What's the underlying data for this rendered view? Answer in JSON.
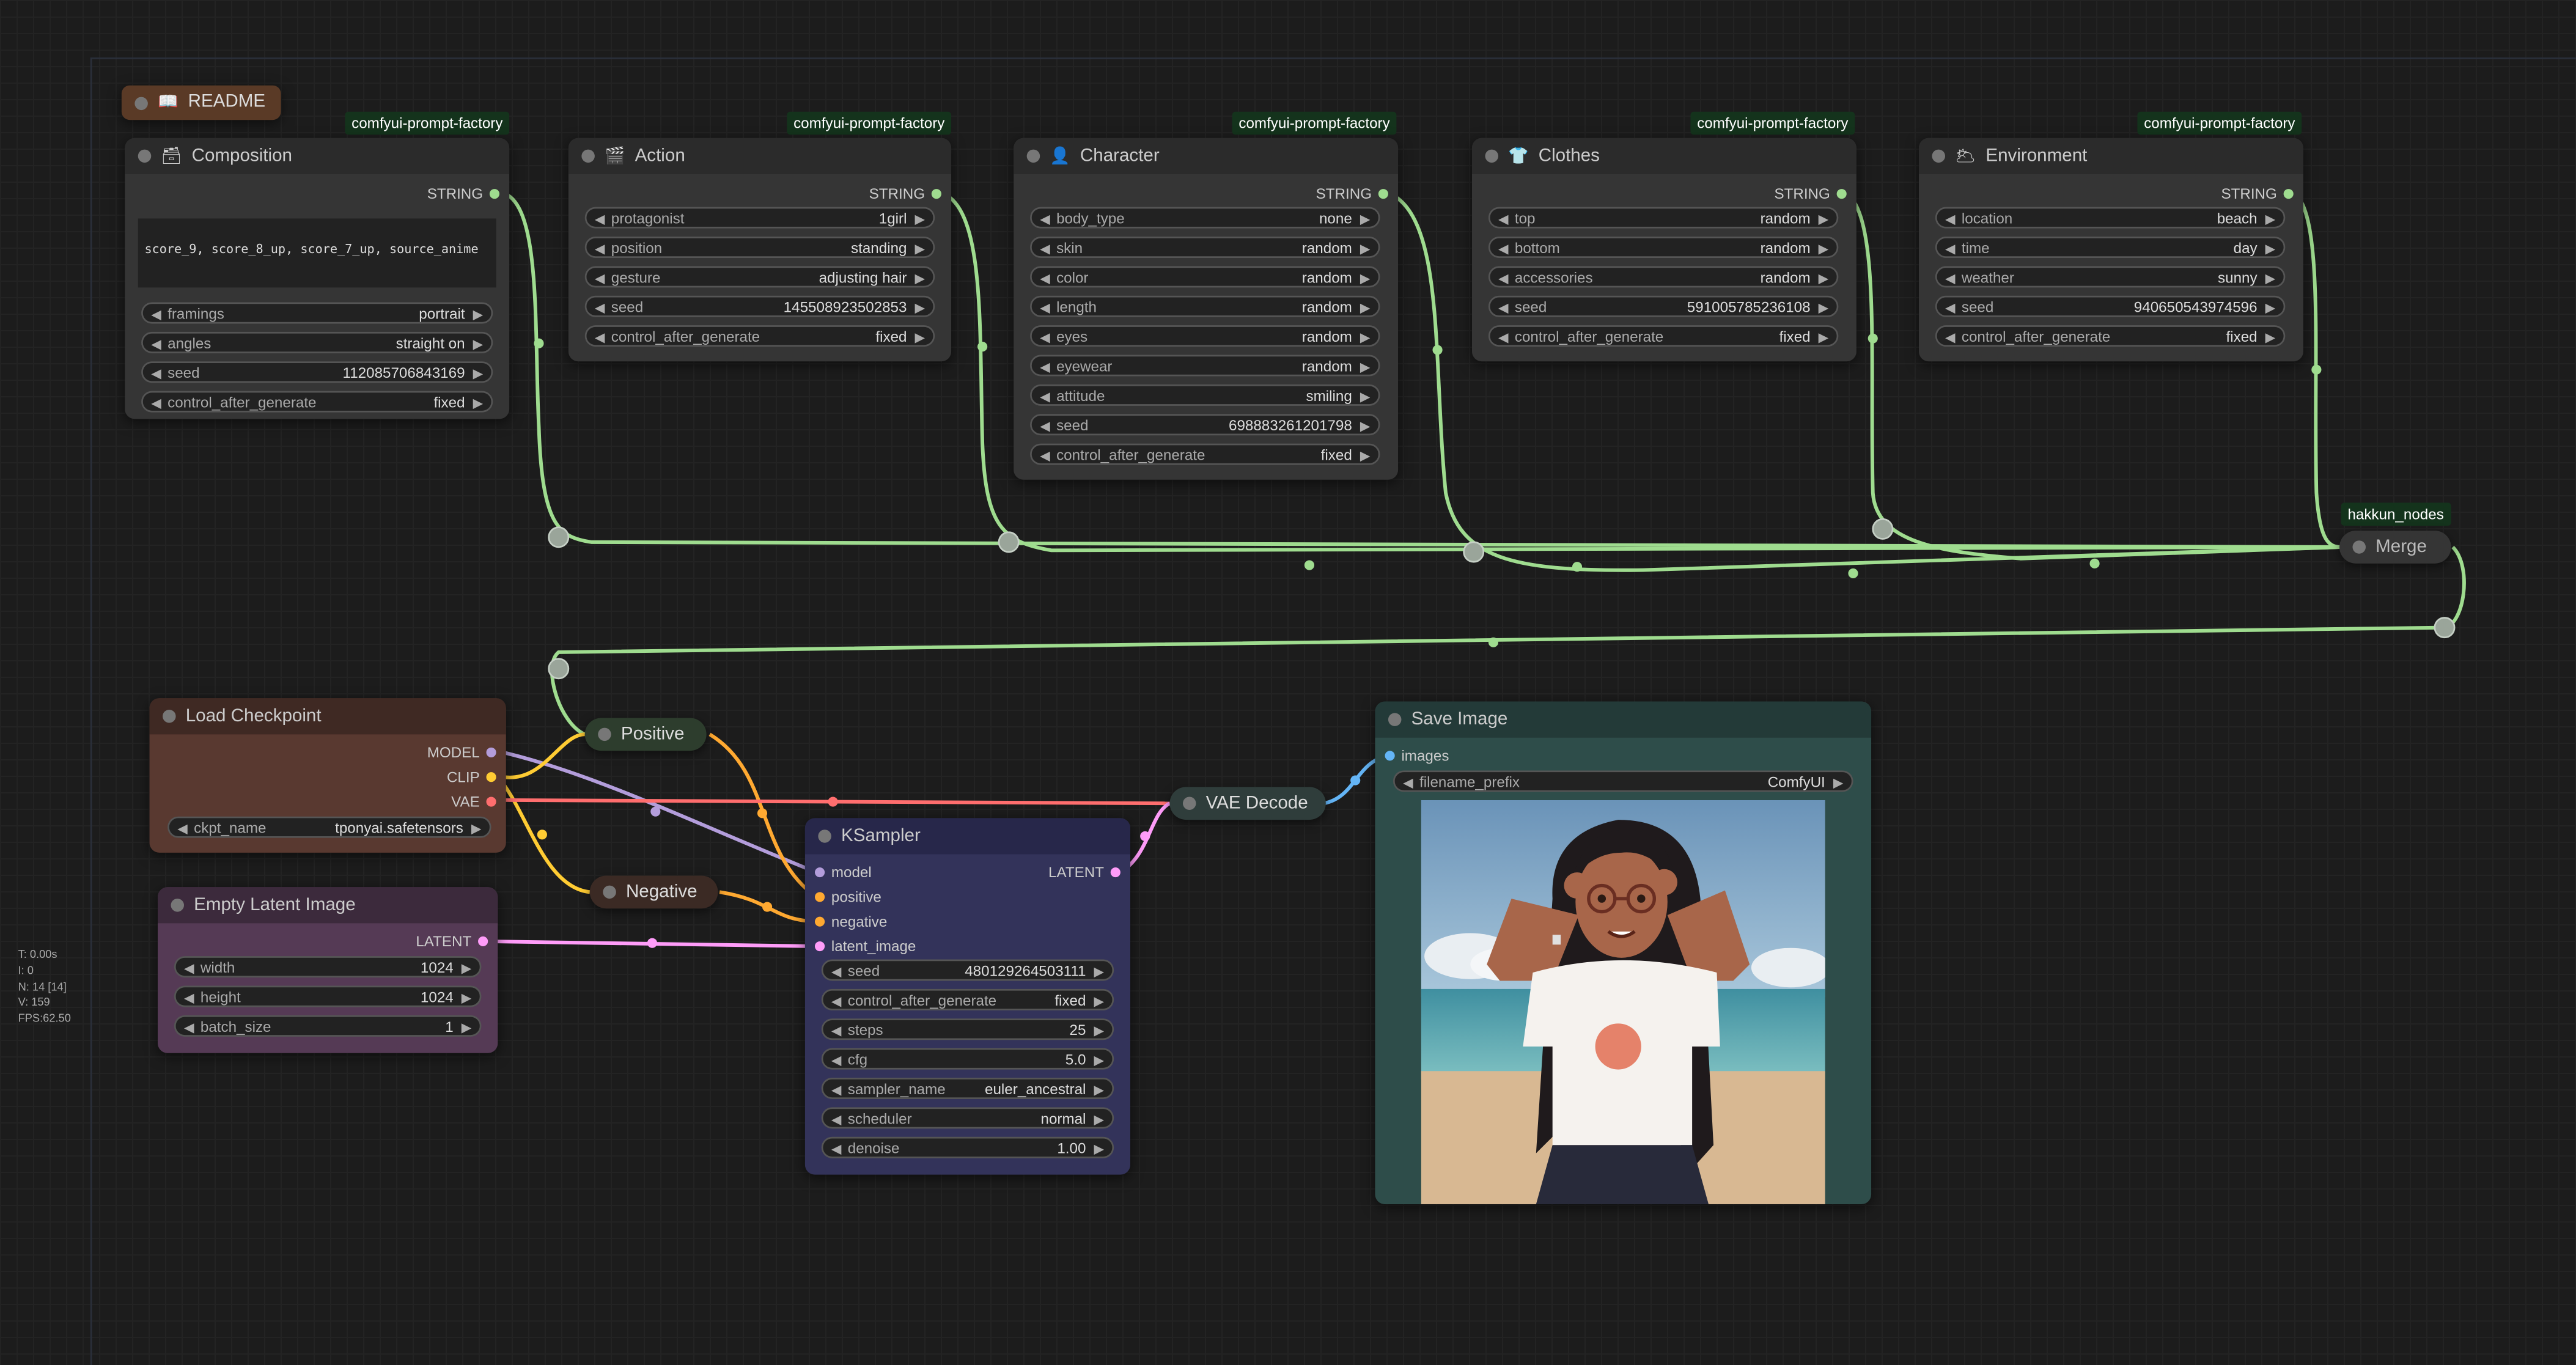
{
  "colors": {
    "string": "#9fdc8f",
    "model": "#b39ddb",
    "clip": "#ffcc33",
    "vae": "#ff6e6e",
    "latent": "#ff9cf9",
    "conditioning": "#ffa931",
    "image": "#64b5f6"
  },
  "stats": {
    "t": "T: 0.00s",
    "i": "I: 0",
    "n": "N: 14 [14]",
    "v": "V: 159",
    "fps": "FPS:62.50"
  },
  "readme": {
    "icon": "book-icon",
    "title": "README"
  },
  "composition": {
    "badge": "comfyui-prompt-factory",
    "title": "Composition",
    "icon": "palette-icon",
    "output": "STRING",
    "text": "score_9, score_8_up, score_7_up, source_anime",
    "widgets": [
      {
        "label": "framings",
        "value": "portrait"
      },
      {
        "label": "angles",
        "value": "straight on"
      },
      {
        "label": "seed",
        "value": "112085706843169"
      },
      {
        "label": "control_after_generate",
        "value": "fixed"
      }
    ]
  },
  "action": {
    "badge": "comfyui-prompt-factory",
    "title": "Action",
    "icon": "clapper-icon",
    "output": "STRING",
    "widgets": [
      {
        "label": "protagonist",
        "value": "1girl"
      },
      {
        "label": "position",
        "value": "standing"
      },
      {
        "label": "gesture",
        "value": "adjusting hair"
      },
      {
        "label": "seed",
        "value": "145508923502853"
      },
      {
        "label": "control_after_generate",
        "value": "fixed"
      }
    ]
  },
  "character": {
    "badge": "comfyui-prompt-factory",
    "title": "Character",
    "icon": "person-icon",
    "output": "STRING",
    "widgets": [
      {
        "label": "body_type",
        "value": "none"
      },
      {
        "label": "skin",
        "value": "random"
      },
      {
        "label": "color",
        "value": "random"
      },
      {
        "label": "length",
        "value": "random"
      },
      {
        "label": "eyes",
        "value": "random"
      },
      {
        "label": "eyewear",
        "value": "random"
      },
      {
        "label": "attitude",
        "value": "smiling"
      },
      {
        "label": "seed",
        "value": "698883261201798"
      },
      {
        "label": "control_after_generate",
        "value": "fixed"
      }
    ]
  },
  "clothes": {
    "badge": "comfyui-prompt-factory",
    "title": "Clothes",
    "icon": "tshirt-icon",
    "output": "STRING",
    "widgets": [
      {
        "label": "top",
        "value": "random"
      },
      {
        "label": "bottom",
        "value": "random"
      },
      {
        "label": "accessories",
        "value": "random"
      },
      {
        "label": "seed",
        "value": "591005785236108"
      },
      {
        "label": "control_after_generate",
        "value": "fixed"
      }
    ]
  },
  "environment": {
    "badge": "comfyui-prompt-factory",
    "title": "Environment",
    "icon": "sun-cloud-icon",
    "output": "STRING",
    "widgets": [
      {
        "label": "location",
        "value": "beach"
      },
      {
        "label": "time",
        "value": "day"
      },
      {
        "label": "weather",
        "value": "sunny"
      },
      {
        "label": "seed",
        "value": "940650543974596"
      },
      {
        "label": "control_after_generate",
        "value": "fixed"
      }
    ]
  },
  "merge": {
    "badge": "hakkun_nodes",
    "title": "Merge"
  },
  "load_checkpoint": {
    "title": "Load Checkpoint",
    "outputs": [
      "MODEL",
      "CLIP",
      "VAE"
    ],
    "widgets": [
      {
        "label": "ckpt_name",
        "value": "tponyai.safetensors"
      }
    ]
  },
  "positive": {
    "title": "Positive"
  },
  "negative": {
    "title": "Negative"
  },
  "empty_latent": {
    "title": "Empty Latent Image",
    "output": "LATENT",
    "widgets": [
      {
        "label": "width",
        "value": "1024"
      },
      {
        "label": "height",
        "value": "1024"
      },
      {
        "label": "batch_size",
        "value": "1"
      }
    ]
  },
  "ksampler": {
    "title": "KSampler",
    "output": "LATENT",
    "inputs": [
      "model",
      "positive",
      "negative",
      "latent_image"
    ],
    "widgets": [
      {
        "label": "seed",
        "value": "480129264503111"
      },
      {
        "label": "control_after_generate",
        "value": "fixed"
      },
      {
        "label": "steps",
        "value": "25"
      },
      {
        "label": "cfg",
        "value": "5.0"
      },
      {
        "label": "sampler_name",
        "value": "euler_ancestral"
      },
      {
        "label": "scheduler",
        "value": "normal"
      },
      {
        "label": "denoise",
        "value": "1.00"
      }
    ]
  },
  "vae_decode": {
    "title": "VAE Decode"
  },
  "save_image": {
    "title": "Save Image",
    "input": "images",
    "widgets": [
      {
        "label": "filename_prefix",
        "value": "ComfyUI"
      }
    ]
  }
}
